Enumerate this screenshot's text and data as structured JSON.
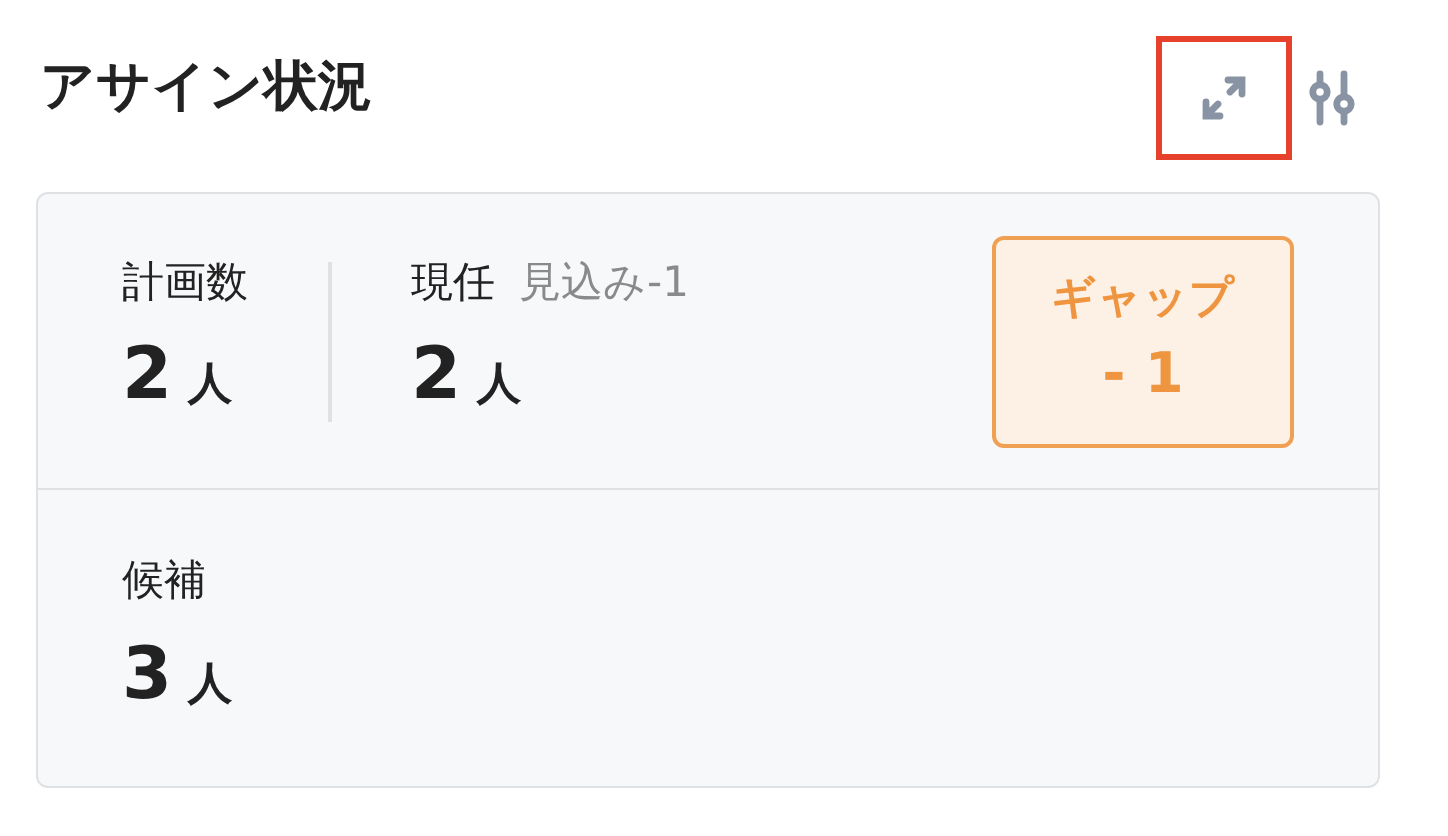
{
  "title": "アサイン状況",
  "toolbar": [
    {
      "kind": "expand",
      "highlighted": true
    },
    {
      "kind": "adjust",
      "highlighted": false
    }
  ],
  "stats": [
    {
      "label": "計画数",
      "value": "2",
      "unit": "人"
    },
    {
      "label": "現任",
      "note": "見込み-1",
      "value": "2",
      "unit": "人"
    }
  ],
  "gap": {
    "label": "ギャップ",
    "value": "- 1"
  },
  "candidates": {
    "label": "候補",
    "value": "3",
    "unit": "人"
  }
}
